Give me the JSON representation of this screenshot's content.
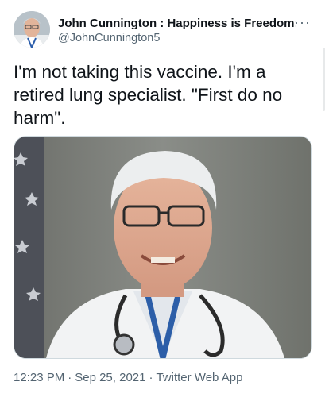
{
  "author": {
    "display_name": "John Cunnington : Happiness is Freedom: Th",
    "handle": "@JohnCunnington5",
    "avatar_icon": "profile-photo"
  },
  "menu": {
    "more_label": "···"
  },
  "tweet": {
    "text": "I'm not taking this vaccine. I'm a retired lung specialist. \"First do no harm\".",
    "media_description": "photo"
  },
  "meta": {
    "time": "12:23 PM",
    "separator": "·",
    "date": "Sep 25, 2021",
    "source": "Twitter Web App"
  },
  "colors": {
    "text": "#0f1419",
    "secondary": "#536471",
    "border": "#cfd9de"
  }
}
